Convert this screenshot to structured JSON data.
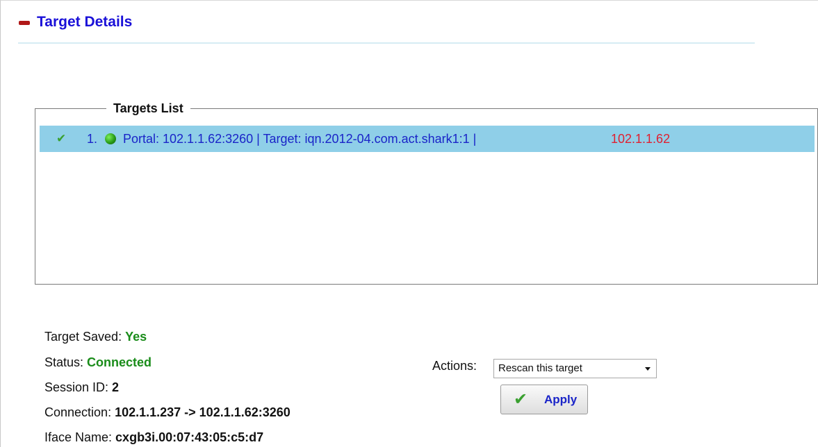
{
  "section": {
    "title": "Target Details"
  },
  "targets_list": {
    "legend": "Targets List",
    "rows": [
      {
        "number": "1.",
        "description": "Portal: 102.1.1.62:3260  |  Target: iqn.2012-04.com.act.shark1:1  |",
        "ip": "102.1.1.62",
        "status_icon": "green-dot-icon",
        "check_icon": "checkmark-icon"
      }
    ]
  },
  "details": {
    "target_saved_label": "Target Saved: ",
    "target_saved_value": "Yes",
    "status_label": "Status: ",
    "status_value": "Connected",
    "session_id_label": "Session ID: ",
    "session_id_value": "2",
    "connection_label": "Connection: ",
    "connection_value": "102.1.1.237 -> 102.1.1.62:3260",
    "iface_label": "Iface Name: ",
    "iface_value": "cxgb3i.00:07:43:05:c5:d7"
  },
  "actions": {
    "label": "Actions:",
    "selected": "Rescan this target",
    "apply_label": "Apply"
  },
  "colors": {
    "title_blue": "#1a10d8",
    "row_highlight": "#8fcfe8",
    "ip_red": "#e02030",
    "status_green": "#1a8c1a"
  }
}
